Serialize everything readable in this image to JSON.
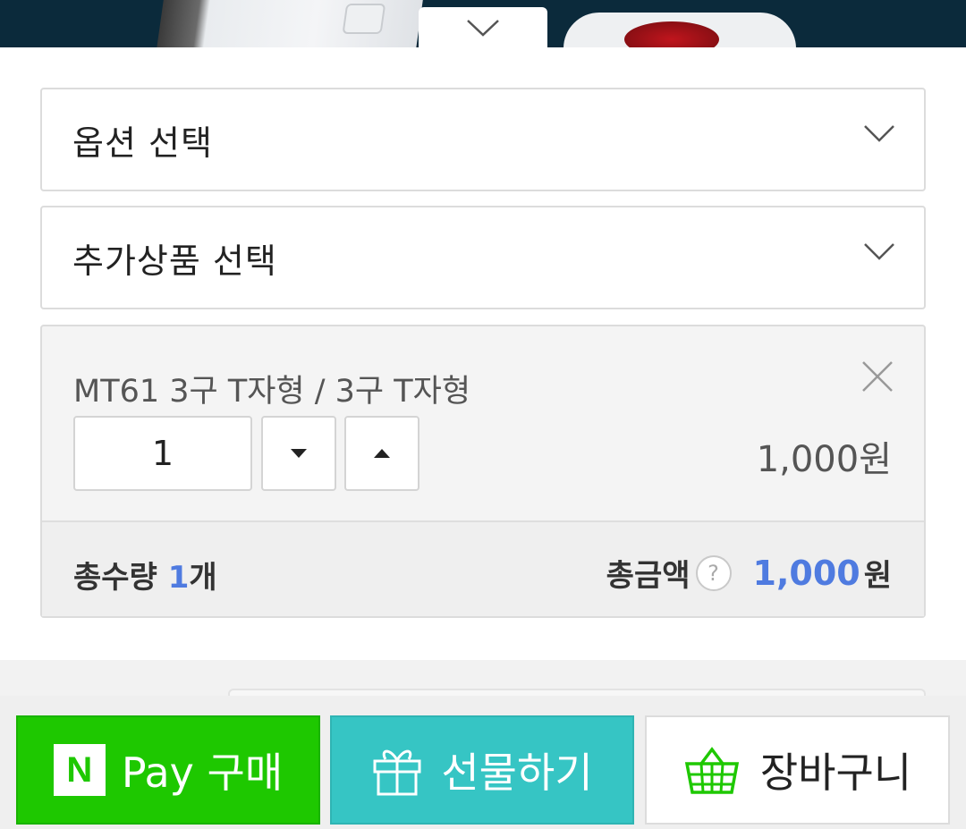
{
  "banner": {
    "toggle_icon": "chevron-down-icon"
  },
  "selects": {
    "option": {
      "label": "옵션 선택",
      "icon": "chevron-down-icon"
    },
    "addon": {
      "label": "추가상품 선택",
      "icon": "chevron-down-icon"
    }
  },
  "selected_item": {
    "name": "MT61 3구 T자형 / 3구 T자형",
    "quantity": "1",
    "price": "1,000원",
    "remove_icon": "close-icon",
    "decrease_icon": "caret-down-icon",
    "increase_icon": "caret-up-icon"
  },
  "summary": {
    "qty_label": "총수량",
    "qty_value": "1",
    "qty_unit": "개",
    "amount_label": "총금액",
    "help_glyph": "?",
    "amount_value": "1,000",
    "amount_unit": "원"
  },
  "actions": {
    "npay": {
      "logo": "N",
      "label": "Pay 구매"
    },
    "gift": {
      "label": "선물하기",
      "icon": "gift-icon"
    },
    "cart": {
      "label": "장바구니",
      "icon": "basket-icon"
    }
  },
  "colors": {
    "npay_green": "#1ec800",
    "gift_teal": "#36c5c4",
    "accent_blue": "#4f7be0"
  }
}
